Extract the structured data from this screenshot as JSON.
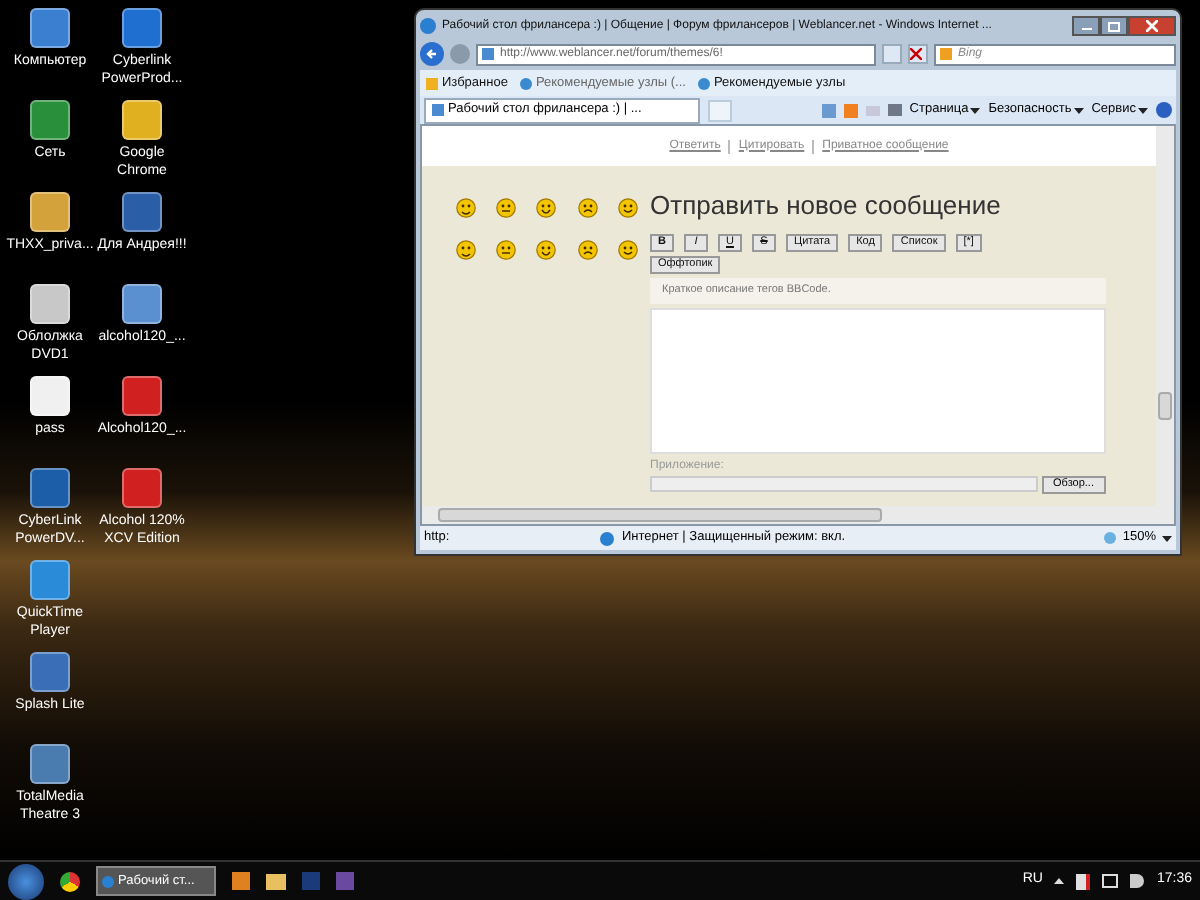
{
  "desktop_icons": [
    {
      "label": "Компьютер"
    },
    {
      "label": "Сеть"
    },
    {
      "label": "THXX_priva..."
    },
    {
      "label": "Облолжка DVD1"
    },
    {
      "label": "pass"
    },
    {
      "label": "CyberLink PowerDV..."
    },
    {
      "label": "QuickTime Player"
    },
    {
      "label": "Splash Lite"
    },
    {
      "label": "TotalMedia Theatre 3"
    },
    {
      "label": "Cyberlink PowerProd..."
    },
    {
      "label": "Google Chrome"
    },
    {
      "label": "Для Андрея!!!"
    },
    {
      "label": "alcohol120_..."
    },
    {
      "label": "Alcohol120_..."
    },
    {
      "label": "Alcohol 120% XCV Edition"
    }
  ],
  "window": {
    "title": "Рабочий стол фрилансера :) | Общение | Форум фрилансеров | Weblancer.net - Windows Internet ...",
    "address": "http://www.weblancer.net/forum/themes/6!",
    "search_placeholder": "Bing",
    "favorites": [
      {
        "label": "Избранное"
      },
      {
        "label": "Рекомендуемые узлы (..."
      },
      {
        "label": "Рекомендуемые узлы"
      }
    ],
    "tab": "Рабочий стол фрилансера :) | ...",
    "commands": [
      {
        "label": "Страница"
      },
      {
        "label": "Безопасность"
      },
      {
        "label": "Сервис"
      }
    ],
    "page": {
      "links": [
        "Ответить",
        "Цитировать",
        "Приватное сообщение"
      ],
      "heading": "Отправить новое сообщение",
      "format_buttons": [
        {
          "label": "B"
        },
        {
          "label": "I"
        },
        {
          "label": "U"
        },
        {
          "label": "S"
        },
        {
          "label": "Цитата"
        },
        {
          "label": "Код"
        },
        {
          "label": "Список"
        },
        {
          "label": "[*]"
        },
        {
          "label": "Оффтопик"
        }
      ],
      "hint": "Краткое описание тегов BBCode.",
      "attachment_label": "Приложение:",
      "browse_button": "Обзор..."
    },
    "status": {
      "url": "http:",
      "zone": "Интернет | Защищенный режим: вкл.",
      "zoom": "150%"
    }
  },
  "taskbar": {
    "active_task": "Рабочий ст...",
    "language": "RU",
    "clock": "17:36"
  }
}
